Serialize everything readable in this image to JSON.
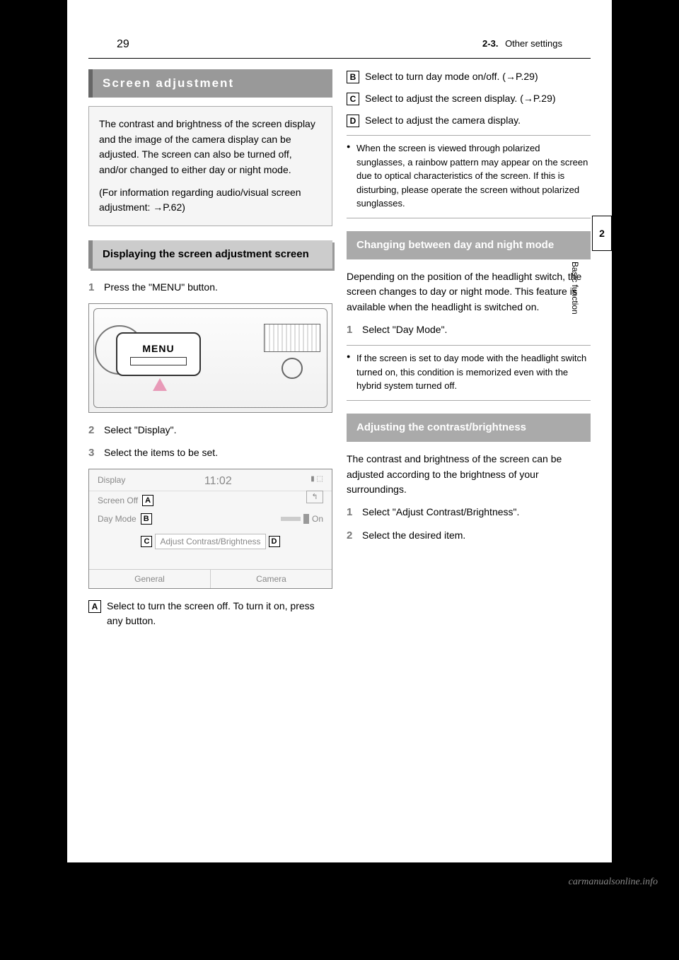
{
  "header": {
    "page_number": "29",
    "chapter_num": "2-3.",
    "chapter_title": "Other settings"
  },
  "side_tab": {
    "number": "2",
    "label": "Basic function"
  },
  "left": {
    "main_title": "Screen adjustment",
    "intro_p1": "The contrast and brightness of the screen display and the image of the camera display can be adjusted. The screen can also be turned off, and/or changed to either day or night mode.",
    "intro_p2": "(For information regarding audio/visual screen adjustment: →P.62)",
    "sub_heading": "Displaying the screen adjustment screen",
    "step1": "Press the \"MENU\" button.",
    "menu_label": "MENU",
    "step2": "Select \"Display\".",
    "step3": "Select the items to be set.",
    "display_screen": {
      "title": "Display",
      "time": "11:02",
      "back_icon": "↰",
      "row_screen_off": "Screen Off",
      "row_day_mode": "Day Mode",
      "toggle_on": "On",
      "center_btn": "Adjust Contrast/Brightness",
      "tab_general": "General",
      "tab_camera": "Camera",
      "label_A": "A",
      "label_B": "B",
      "label_C": "C",
      "label_D": "D"
    },
    "item_A": "Select to turn the screen off. To turn it on, press any button."
  },
  "right": {
    "item_B": "Select to turn day mode on/off. (→P.29)",
    "item_C": "Select to adjust the screen display. (→P.29)",
    "item_D": "Select to adjust the camera display.",
    "note1": "When the screen is viewed through polarized sunglasses, a rainbow pattern may appear on the screen due to optical characteristics of the screen. If this is disturbing, please operate the screen without polarized sunglasses.",
    "sub_heading_day": "Changing between day and night mode",
    "day_p1": "Depending on the position of the headlight switch, the screen changes to day or night mode. This feature is available when the headlight is switched on.",
    "day_step1": "Select \"Day Mode\".",
    "note2": "If the screen is set to day mode with the headlight switch turned on, this condition is memorized even with the hybrid system turned off.",
    "sub_heading_adjust": "Adjusting the contrast/brightness",
    "adjust_p1": "The contrast and brightness of the screen can be adjusted according to the brightness of your surroundings.",
    "adjust_step1": "Select \"Adjust Contrast/Brightness\".",
    "adjust_step2": "Select the desired item."
  },
  "footer": {
    "url": "carmanualsonline.info"
  }
}
